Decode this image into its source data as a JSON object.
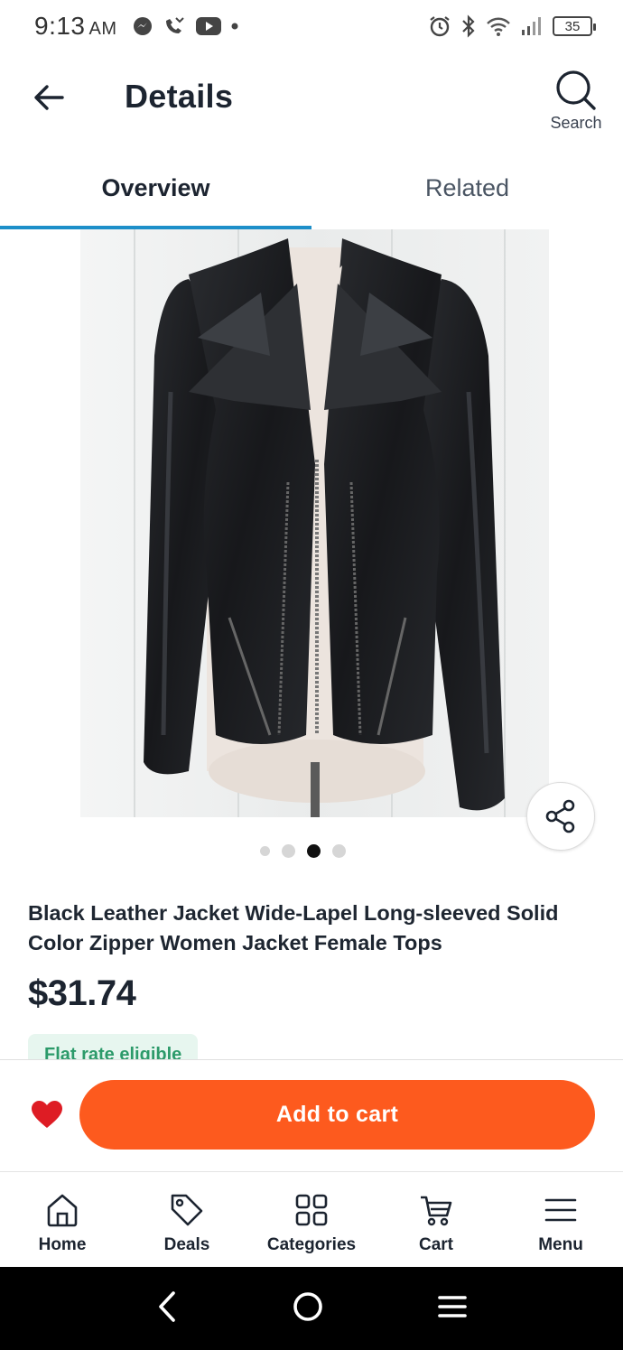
{
  "status_bar": {
    "time": "9:13",
    "ampm": "AM",
    "battery": "35"
  },
  "header": {
    "title": "Details",
    "search_label": "Search"
  },
  "tabs": [
    {
      "label": "Overview",
      "active": true
    },
    {
      "label": "Related",
      "active": false
    }
  ],
  "product": {
    "image_alt": "Black leather jacket",
    "carousel": {
      "count": 4,
      "active_index": 2
    },
    "title": "Black Leather Jacket Wide-Lapel Long-sleeved Solid Color Zipper Women Jacket Female Tops",
    "price": "$31.74",
    "badge": "Flat rate eligible"
  },
  "cart_bar": {
    "add_to_cart_label": "Add to cart",
    "favorite_color": "#de1c24",
    "button_color": "#fd5a1e"
  },
  "bottom_nav": [
    {
      "label": "Home",
      "icon": "home-icon"
    },
    {
      "label": "Deals",
      "icon": "tag-icon"
    },
    {
      "label": "Categories",
      "icon": "grid-icon"
    },
    {
      "label": "Cart",
      "icon": "cart-icon"
    },
    {
      "label": "Menu",
      "icon": "menu-icon"
    }
  ],
  "accent_colors": {
    "tab_indicator": "#1d8fc9",
    "badge_text": "#2c9a6a",
    "badge_bg": "#e7f6ef"
  }
}
